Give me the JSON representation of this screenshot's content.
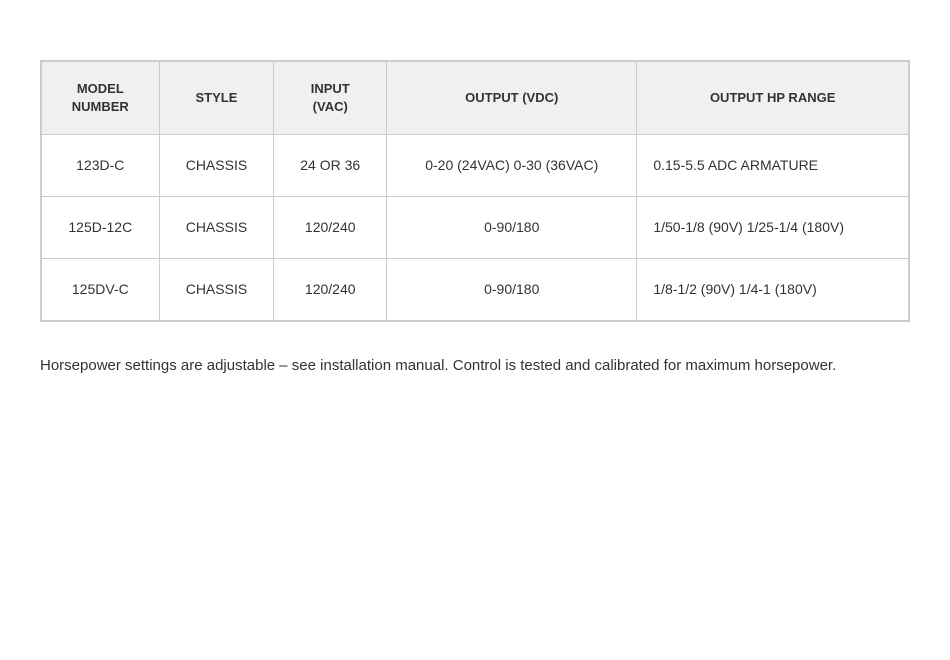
{
  "table": {
    "headers": [
      {
        "id": "model-number",
        "label": "MODEL\nNUMBER"
      },
      {
        "id": "style",
        "label": "STYLE"
      },
      {
        "id": "input-vac",
        "label": "INPUT\n(VAC)"
      },
      {
        "id": "output-vdc",
        "label": "OUTPUT (VDC)"
      },
      {
        "id": "output-hp-range",
        "label": "OUTPUT HP RANGE"
      }
    ],
    "rows": [
      {
        "model": "123D-C",
        "style": "CHASSIS",
        "input": "24 OR 36",
        "output_vdc": "0-20 (24VAC) 0-30 (36VAC)",
        "output_hp": "0.15-5.5 ADC ARMATURE"
      },
      {
        "model": "125D-12C",
        "style": "CHASSIS",
        "input": "120/240",
        "output_vdc": "0-90/180",
        "output_hp": "1/50-1/8 (90V) 1/25-1/4 (180V)"
      },
      {
        "model": "125DV-C",
        "style": "CHASSIS",
        "input": "120/240",
        "output_vdc": "0-90/180",
        "output_hp": "1/8-1/2 (90V) 1/4-1 (180V)"
      }
    ]
  },
  "footnote": "Horsepower settings are adjustable – see installation manual. Control is tested and calibrated for maximum horsepower."
}
